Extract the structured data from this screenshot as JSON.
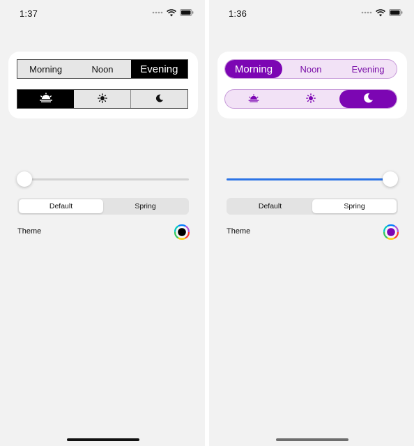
{
  "screens": [
    {
      "status": {
        "time": "1:37"
      },
      "period_segments": [
        {
          "label": "Morning",
          "selected": false
        },
        {
          "label": "Noon",
          "selected": false
        },
        {
          "label": "Evening",
          "selected": true
        }
      ],
      "icon_segments": [
        {
          "icon": "sunrise-icon",
          "selected": true
        },
        {
          "icon": "sun-icon",
          "selected": false
        },
        {
          "icon": "moon-icon",
          "selected": false
        }
      ],
      "slider": {
        "value": 0.0
      },
      "style_segments": [
        {
          "label": "Default",
          "selected": true
        },
        {
          "label": "Spring",
          "selected": false
        }
      ],
      "theme": {
        "label": "Theme",
        "color": "#000000"
      },
      "colors": {
        "accent": "#000000",
        "selected_text": "#ffffff"
      }
    },
    {
      "status": {
        "time": "1:36"
      },
      "period_segments": [
        {
          "label": "Morning",
          "selected": true
        },
        {
          "label": "Noon",
          "selected": false
        },
        {
          "label": "Evening",
          "selected": false
        }
      ],
      "icon_segments": [
        {
          "icon": "sunrise-icon",
          "selected": false
        },
        {
          "icon": "sun-icon",
          "selected": false
        },
        {
          "icon": "moon-icon",
          "selected": true
        }
      ],
      "slider": {
        "value": 1.0
      },
      "style_segments": [
        {
          "label": "Default",
          "selected": false
        },
        {
          "label": "Spring",
          "selected": true
        }
      ],
      "theme": {
        "label": "Theme",
        "color": "#7c06b3"
      },
      "colors": {
        "accent": "#7c06b3",
        "slider_fill": "#2c74e6",
        "pill_background": "#f2e2f6"
      }
    }
  ]
}
